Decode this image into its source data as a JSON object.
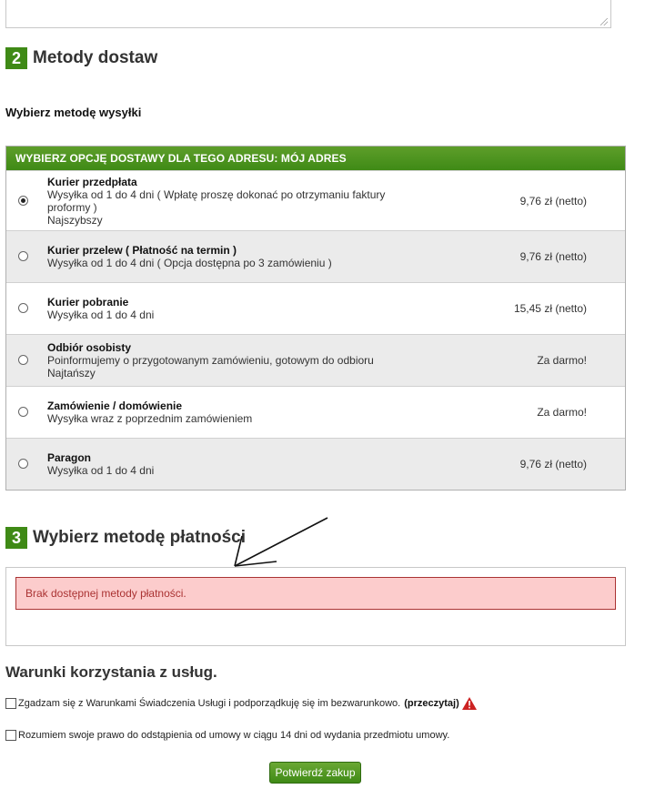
{
  "shipping": {
    "step": "2",
    "title": "Metody dostaw",
    "subtitle": "Wybierz metodę wysyłki",
    "table_header": "Wybierz opcję dostawy dla tego adresu: Mój adres",
    "options": [
      {
        "name": "Kurier przedpłata",
        "lines": [
          "Wysyłka od 1 do 4 dni ( Wpłatę proszę dokonać po otrzymaniu faktury",
          "proformy )",
          "Najszybszy"
        ],
        "price": "9,76 zł (netto)",
        "selected": true
      },
      {
        "name": "Kurier przelew ( Płatność na termin )",
        "lines": [
          "Wysyłka od 1 do 4 dni ( Opcja dostępna po 3 zamówieniu )"
        ],
        "price": "9,76 zł (netto)",
        "selected": false
      },
      {
        "name": "Kurier pobranie",
        "lines": [
          "Wysyłka od 1 do 4 dni"
        ],
        "price": "15,45 zł (netto)",
        "selected": false
      },
      {
        "name": "Odbiór osobisty",
        "lines": [
          "Poinformujemy o przygotowanym zamówieniu, gotowym do odbioru",
          "Najtańszy"
        ],
        "price": "Za darmo!",
        "selected": false
      },
      {
        "name": "Zamówienie / domówienie",
        "lines": [
          "Wysyłka wraz z poprzednim zamówieniem"
        ],
        "price": "Za darmo!",
        "selected": false
      },
      {
        "name": "Paragon",
        "lines": [
          "Wysyłka od 1 do 4 dni"
        ],
        "price": "9,76 zł (netto)",
        "selected": false
      }
    ]
  },
  "payment": {
    "step": "3",
    "title": "Wybierz metodę płatności",
    "alert": "Brak dostępnej metody płatności."
  },
  "terms": {
    "title": "Warunki korzystania z usług.",
    "agree_text": "Zgadzam się z Warunkami Świadczenia Usługi i podporządkuję się im bezwarunkowo.",
    "read_link": "(przeczytaj)",
    "withdrawal_text": "Rozumiem swoje prawo do odstąpienia od umowy w ciągu 14 dni od wydania przedmiotu umowy."
  },
  "confirm_button": "Potwierdź zakup",
  "colors": {
    "accent": "#3f8a16",
    "alert_bg": "#fccccc",
    "alert_text": "#aa3333",
    "warning": "#cc2222"
  }
}
